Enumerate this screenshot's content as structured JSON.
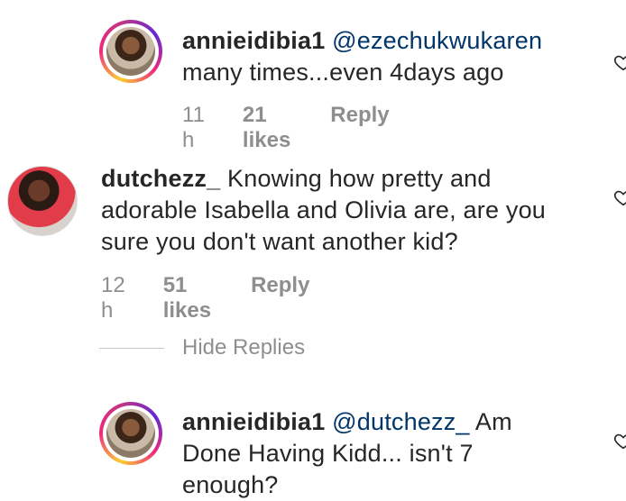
{
  "comments": [
    {
      "username": "annieidibia1",
      "mention": "@ezechukwukaren",
      "text_line1_rest": "",
      "text_line2": "many times...even 4days ago",
      "time": "11 h",
      "likes": "21 likes",
      "reply": "Reply"
    },
    {
      "username": "dutchezz_",
      "text_line1_rest": "Knowing how pretty and",
      "text_line2": "adorable Isabella and Olivia are, are you",
      "text_line3": "sure you don't want another kid?",
      "time": "12 h",
      "likes": "51 likes",
      "reply": "Reply"
    },
    {
      "username": "annieidibia1",
      "mention": "@dutchezz_",
      "text_line1_rest": "Am",
      "text_line2": "Done Having Kidd... isn't 7",
      "text_line3": "enough?"
    }
  ],
  "hide_replies_label": "Hide Replies",
  "icons": {
    "like": "heart-outline-icon"
  },
  "colors": {
    "mention": "#003569",
    "meta": "#8e8e8e",
    "text": "#262626"
  }
}
